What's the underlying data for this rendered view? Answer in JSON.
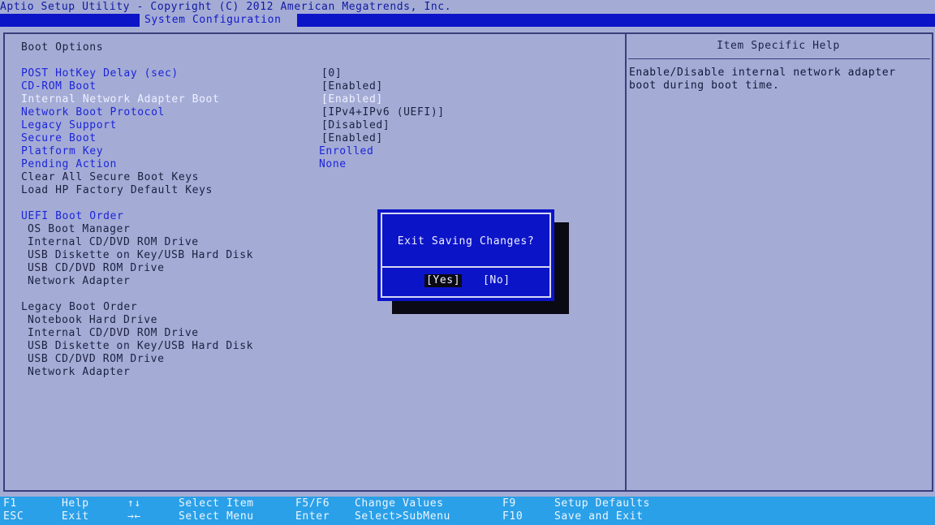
{
  "header": {
    "title": "Aptio Setup Utility - Copyright (C) 2012 American Megatrends, Inc.",
    "active_tab": "System Configuration"
  },
  "boot_options": {
    "heading": "Boot Options",
    "items": [
      {
        "label": "POST HotKey Delay (sec)",
        "value": "[0]"
      },
      {
        "label": "CD-ROM Boot",
        "value": "[Enabled]"
      },
      {
        "label": "Internal Network Adapter Boot",
        "value": "[Enabled]"
      },
      {
        "label": "Network Boot Protocol",
        "value": "[IPv4+IPv6 (UEFI)]"
      },
      {
        "label": "Legacy Support",
        "value": "[Disabled]"
      },
      {
        "label": "Secure Boot",
        "value": "[Enabled]"
      },
      {
        "label": "Platform Key",
        "value": "Enrolled"
      },
      {
        "label": "Pending Action",
        "value": "None"
      },
      {
        "label": "Clear All Secure Boot Keys"
      },
      {
        "label": "Load HP Factory Default Keys"
      }
    ],
    "uefi_heading": "UEFI Boot Order",
    "uefi_items": [
      "OS Boot Manager",
      "Internal CD/DVD ROM Drive",
      "USB Diskette on Key/USB Hard Disk",
      "USB CD/DVD ROM Drive",
      "Network Adapter"
    ],
    "legacy_heading": "Legacy Boot Order",
    "legacy_items": [
      "Notebook Hard Drive",
      "Internal CD/DVD ROM Drive",
      "USB Diskette on Key/USB Hard Disk",
      "USB CD/DVD ROM Drive",
      "Network Adapter"
    ]
  },
  "help": {
    "heading": "Item Specific Help",
    "text": "Enable/Disable internal network adapter\nboot during boot time."
  },
  "dialog": {
    "message": "Exit Saving Changes?",
    "yes": "[Yes]",
    "no": "[No]"
  },
  "footer": {
    "keys": [
      {
        "key": "F1",
        "action": "Help"
      },
      {
        "key": "ESC",
        "action": "Exit"
      },
      {
        "key": "↑↓",
        "action": "Select Item"
      },
      {
        "key": "→←",
        "action": "Select Menu"
      },
      {
        "key": "F5/F6",
        "action": "Change Values"
      },
      {
        "key": "Enter",
        "action": "Select>SubMenu"
      },
      {
        "key": "F9",
        "action": "Setup Defaults"
      },
      {
        "key": "F10",
        "action": "Save and Exit"
      }
    ]
  },
  "colors": {
    "background": "#a4acd6",
    "accent_blue": "#0c14c8",
    "footer": "#2aa0e8"
  }
}
